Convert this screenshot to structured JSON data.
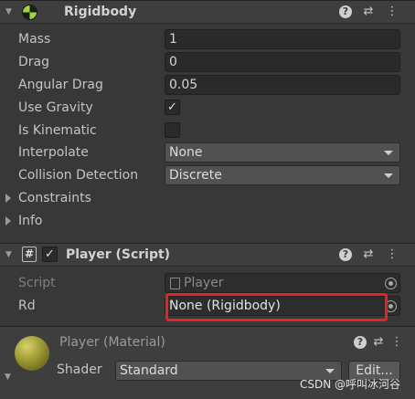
{
  "rigidbody": {
    "title": "Rigidbody",
    "fields": {
      "mass": {
        "label": "Mass",
        "value": "1"
      },
      "drag": {
        "label": "Drag",
        "value": "0"
      },
      "angular_drag": {
        "label": "Angular Drag",
        "value": "0.05"
      },
      "use_gravity": {
        "label": "Use Gravity",
        "checked": true
      },
      "is_kinematic": {
        "label": "Is Kinematic",
        "checked": false
      },
      "interpolate": {
        "label": "Interpolate",
        "value": "None"
      },
      "collision_detection": {
        "label": "Collision Detection",
        "value": "Discrete"
      }
    },
    "foldouts": {
      "constraints": "Constraints",
      "info": "Info"
    }
  },
  "player_script": {
    "title": "Player (Script)",
    "enabled": true,
    "script": {
      "label": "Script",
      "value": "Player"
    },
    "rd": {
      "label": "Rd",
      "value": "None (Rigidbody)"
    }
  },
  "material": {
    "title": "Player (Material)",
    "shader_label": "Shader",
    "shader_value": "Standard",
    "edit_button": "Edit..."
  },
  "icons": {
    "help": "?",
    "check": "✓",
    "script": "#"
  },
  "watermark": "CSDN @呼叫冰河谷",
  "colors": {
    "highlight": "#e62222",
    "background": "#383838",
    "header": "#3e3e3e"
  }
}
